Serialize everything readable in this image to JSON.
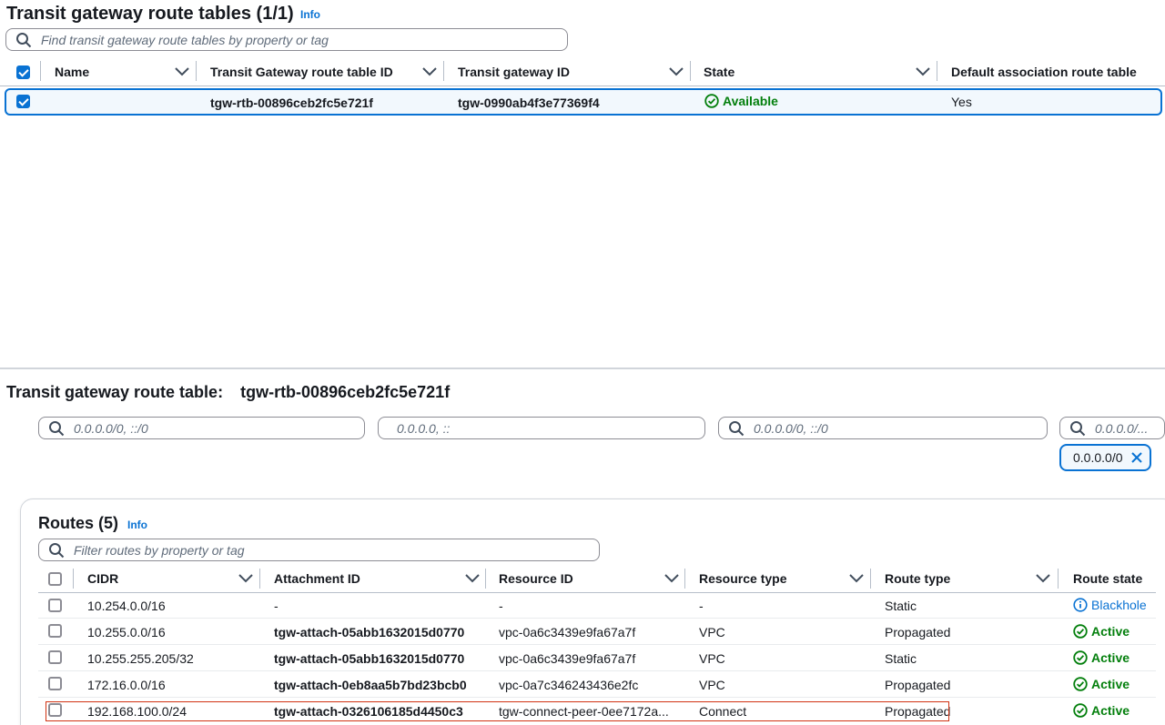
{
  "top": {
    "title": "Transit gateway route tables (1/1)",
    "info": "Info",
    "search_placeholder": "Find transit gateway route tables by property or tag",
    "columns": [
      "Name",
      "Transit Gateway route table ID",
      "Transit gateway ID",
      "State",
      "Default association route table"
    ],
    "row": {
      "name": "",
      "rtb_id": "tgw-rtb-00896ceb2fc5e721f",
      "tgw_id": "tgw-0990ab4f3e77369f4",
      "state": "Available",
      "default_assoc": "Yes"
    }
  },
  "detail": {
    "label": "Transit gateway route table:",
    "rtb_id": "tgw-rtb-00896ceb2fc5e721f",
    "filters": [
      "0.0.0.0/0, ::/0",
      "0.0.0.0, ::",
      "0.0.0.0/0, ::/0",
      "0.0.0.0/..."
    ],
    "token": "0.0.0.0/0"
  },
  "routes": {
    "title": "Routes (5)",
    "info": "Info",
    "search_placeholder": "Filter routes by property or tag",
    "columns": [
      "CIDR",
      "Attachment ID",
      "Resource ID",
      "Resource type",
      "Route type",
      "Route state"
    ],
    "rows": [
      {
        "cidr": "10.254.0.0/16",
        "attachment": "-",
        "resource_id": "-",
        "resource_type": "-",
        "route_type": "Static",
        "state": "Blackhole"
      },
      {
        "cidr": "10.255.0.0/16",
        "attachment": "tgw-attach-05abb1632015d0770",
        "resource_id": "vpc-0a6c3439e9fa67a7f",
        "resource_type": "VPC",
        "route_type": "Propagated",
        "state": "Active"
      },
      {
        "cidr": "10.255.255.205/32",
        "attachment": "tgw-attach-05abb1632015d0770",
        "resource_id": "vpc-0a6c3439e9fa67a7f",
        "resource_type": "VPC",
        "route_type": "Static",
        "state": "Active"
      },
      {
        "cidr": "172.16.0.0/16",
        "attachment": "tgw-attach-0eb8aa5b7bd23bcb0",
        "resource_id": "vpc-0a7c346243436e2fc",
        "resource_type": "VPC",
        "route_type": "Propagated",
        "state": "Active"
      },
      {
        "cidr": "192.168.100.0/24",
        "attachment": "tgw-attach-0326106185d4450c3",
        "resource_id": "tgw-connect-peer-0ee7172a...",
        "resource_type": "Connect",
        "route_type": "Propagated",
        "state": "Active"
      }
    ]
  },
  "colors": {
    "accent": "#0972d3",
    "success": "#037f0c",
    "highlight": "#d13212",
    "selected_bg": "#f2f8fd"
  }
}
